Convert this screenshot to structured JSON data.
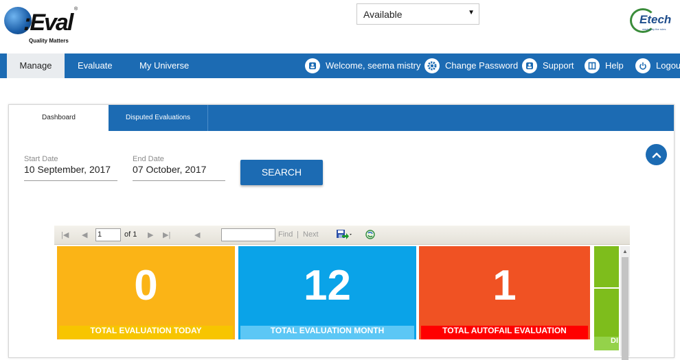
{
  "header": {
    "logo_text": "Q-Eval",
    "logo_tagline": "Quality Matters",
    "status_value": "Available",
    "brand_logo_text": "Etech",
    "brand_logo_sub": "staying by the rules"
  },
  "nav": {
    "tabs": [
      {
        "label": "Manage"
      },
      {
        "label": "Evaluate"
      },
      {
        "label": "My Universe"
      }
    ],
    "right_items": [
      {
        "label": "Welcome, seema mistry",
        "icon": "user-icon"
      },
      {
        "label": "Change Password",
        "icon": "gear-icon"
      },
      {
        "label": "Support",
        "icon": "support-icon"
      },
      {
        "label": "Help",
        "icon": "book-icon"
      },
      {
        "label": "Logout",
        "icon": "power-icon"
      }
    ]
  },
  "panel": {
    "tabs": [
      {
        "label": "Dashboard"
      },
      {
        "label": "Disputed Evaluations"
      }
    ],
    "start_date": {
      "label": "Start Date",
      "value": "10 September, 2017"
    },
    "end_date": {
      "label": "End Date",
      "value": "07 October, 2017"
    },
    "search_label": "SEARCH"
  },
  "report_toolbar": {
    "page_value": "1",
    "page_of": "of 1",
    "find_label": "Find",
    "separator": "|",
    "next_label": "Next",
    "find_value": ""
  },
  "tiles": [
    {
      "value": "0",
      "caption": "TOTAL EVALUATION  TODAY",
      "color": "#fbb416",
      "caption_color": "#f7c500"
    },
    {
      "value": "12",
      "caption": "TOTAL EVALUATION MONTH",
      "color": "#0aa3e8",
      "caption_color": "#5cc7f5"
    },
    {
      "value": "1",
      "caption": "TOTAL AUTOFAIL EVALUATION",
      "color": "#f05223",
      "caption_color": "#ff0000"
    },
    {
      "value": "",
      "caption": "DI",
      "color": "#7ebd1c",
      "caption_color": "#94d24a"
    }
  ],
  "colors": {
    "nav_blue": "#1c6bb3",
    "active_tab_bg": "#e9ecef"
  }
}
